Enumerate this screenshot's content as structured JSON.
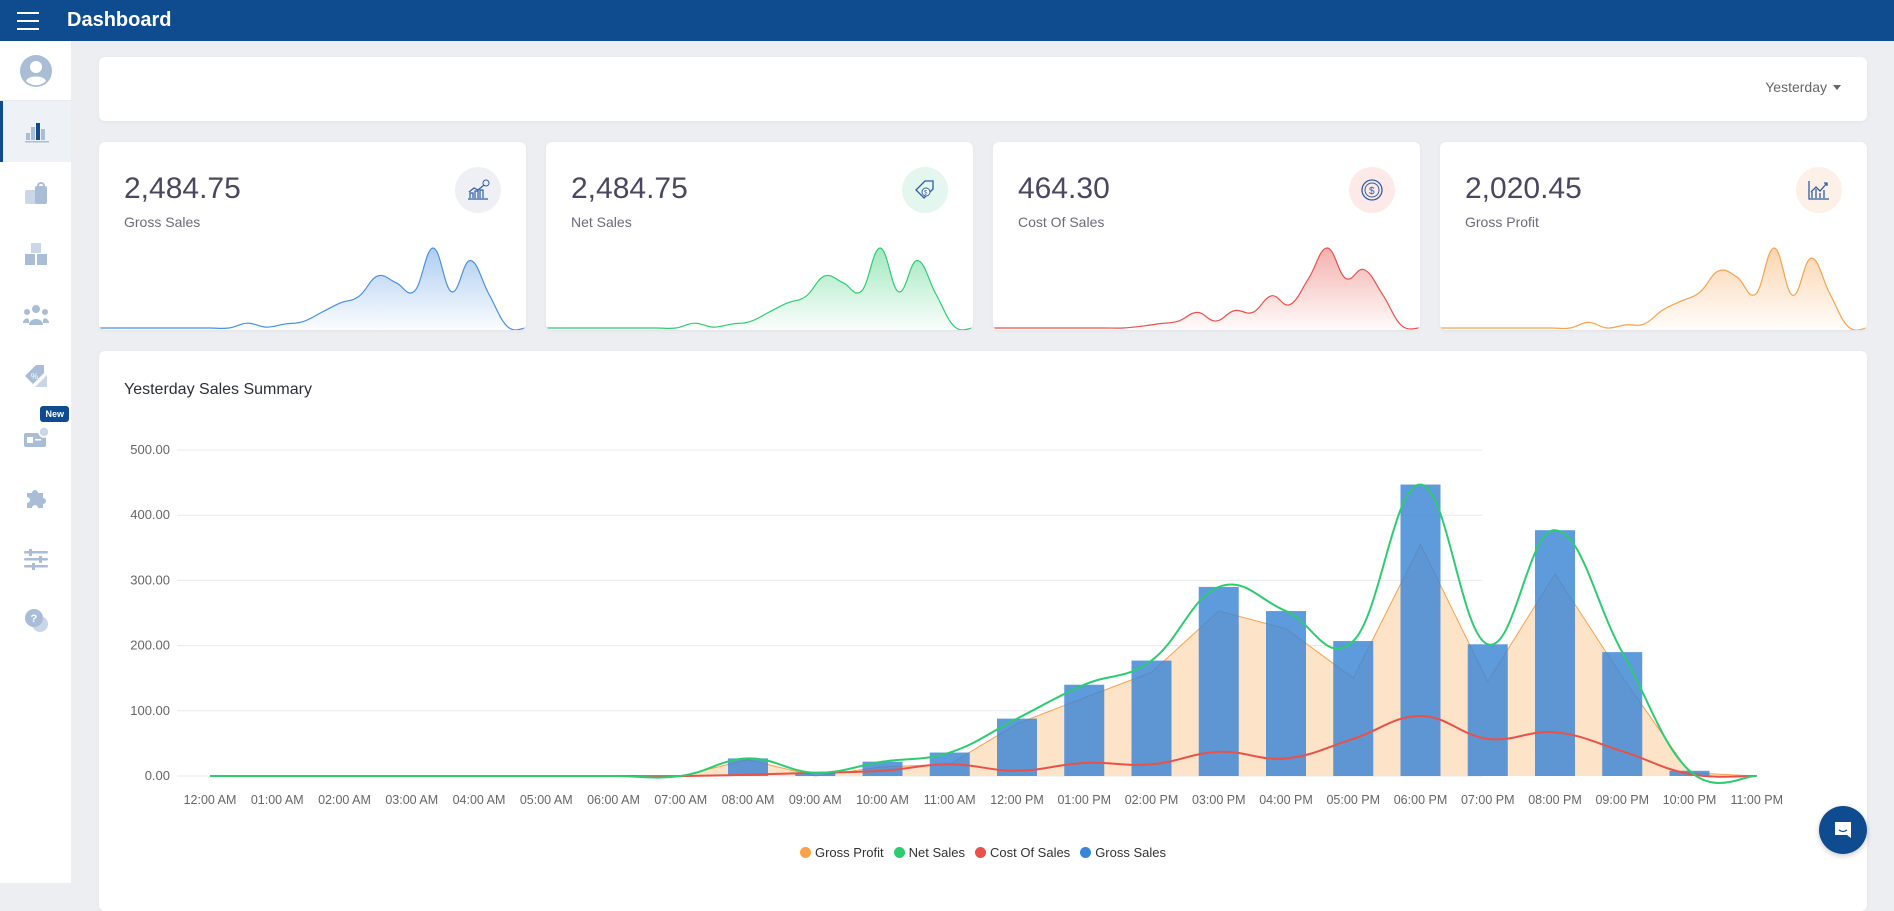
{
  "header": {
    "title": "Dashboard"
  },
  "sidebar": {
    "items": [
      {
        "icon": "user-avatar-icon"
      },
      {
        "icon": "bar-chart-icon",
        "active": true
      },
      {
        "icon": "shopping-bag-icon"
      },
      {
        "icon": "boxes-icon"
      },
      {
        "icon": "users-icon"
      },
      {
        "icon": "discount-tag-icon"
      },
      {
        "icon": "id-card-icon",
        "badge": "New"
      },
      {
        "icon": "puzzle-icon"
      },
      {
        "icon": "sliders-icon"
      },
      {
        "icon": "help-chat-icon"
      }
    ]
  },
  "filter": {
    "selected": "Yesterday"
  },
  "stats": [
    {
      "value": "2,484.75",
      "label": "Gross Sales",
      "color": "#4a90e2",
      "icon_bg": "#eef0f5",
      "icon": "growth-chart-icon"
    },
    {
      "value": "2,484.75",
      "label": "Net Sales",
      "color": "#2ecc71",
      "icon_bg": "#e3f7ee",
      "icon": "price-tag-icon"
    },
    {
      "value": "464.30",
      "label": "Cost Of Sales",
      "color": "#e8524a",
      "icon_bg": "#fde9e7",
      "icon": "coin-icon"
    },
    {
      "value": "2,020.45",
      "label": "Gross Profit",
      "color": "#f7a24d",
      "icon_bg": "#fdf0e6",
      "icon": "line-chart-icon"
    }
  ],
  "chart_title": "Yesterday Sales Summary",
  "chart_data": {
    "type": "bar+line",
    "title": "Yesterday Sales Summary",
    "categories": [
      "12:00 AM",
      "01:00 AM",
      "02:00 AM",
      "03:00 AM",
      "04:00 AM",
      "05:00 AM",
      "06:00 AM",
      "07:00 AM",
      "08:00 AM",
      "09:00 AM",
      "10:00 AM",
      "11:00 AM",
      "12:00 PM",
      "01:00 PM",
      "02:00 PM",
      "03:00 PM",
      "04:00 PM",
      "05:00 PM",
      "06:00 PM",
      "07:00 PM",
      "08:00 PM",
      "09:00 PM",
      "10:00 PM",
      "11:00 PM"
    ],
    "yticks": [
      "0.00",
      "100.00",
      "200.00",
      "300.00",
      "400.00",
      "500.00"
    ],
    "ylim": [
      0,
      500
    ],
    "grid": true,
    "legend_position": "bottom",
    "series": [
      {
        "name": "Gross Profit",
        "type": "area",
        "color": "#f7a24d",
        "values": [
          0,
          0,
          0,
          0,
          0,
          0,
          0,
          0,
          25,
          0,
          14,
          18,
          80,
          120,
          159,
          253,
          226,
          150,
          355,
          145,
          310,
          152,
          5,
          0
        ]
      },
      {
        "name": "Net Sales",
        "type": "line",
        "color": "#2ecc71",
        "values": [
          0,
          0,
          0,
          0,
          0,
          0,
          0,
          0,
          27,
          5,
          22,
          36,
          88,
          140,
          177,
          290,
          253,
          207,
          447,
          202,
          377,
          190,
          8,
          0
        ]
      },
      {
        "name": "Cost Of Sales",
        "type": "line",
        "color": "#e8524a",
        "values": [
          0,
          0,
          0,
          0,
          0,
          0,
          0,
          0,
          2,
          5,
          8,
          18,
          8,
          20,
          18,
          37,
          27,
          57,
          92,
          57,
          67,
          38,
          3,
          0
        ]
      },
      {
        "name": "Gross Sales",
        "type": "bar",
        "color": "#4a90d9",
        "values": [
          0,
          0,
          0,
          0,
          0,
          0,
          0,
          0,
          27,
          5,
          22,
          36,
          88,
          140,
          177,
          290,
          253,
          207,
          447,
          202,
          377,
          190,
          8,
          0
        ]
      }
    ]
  }
}
